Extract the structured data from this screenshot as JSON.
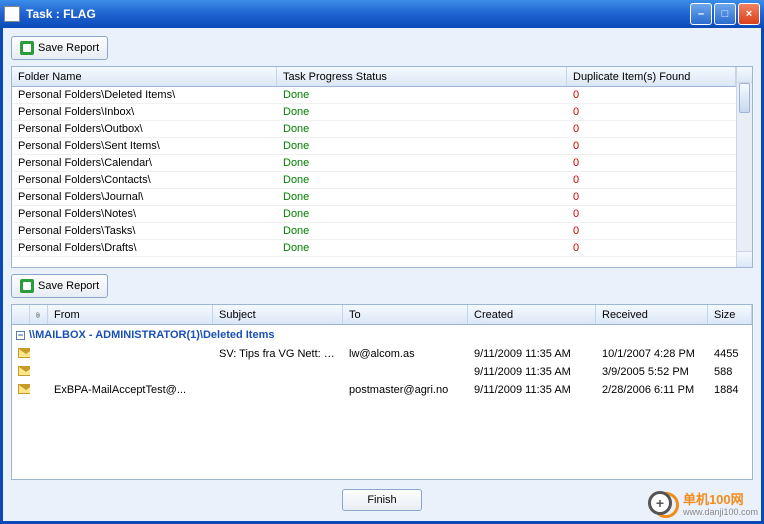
{
  "window": {
    "title": "Task : FLAG"
  },
  "toolbar": {
    "save_report": "Save Report"
  },
  "grid1": {
    "headers": {
      "folder": "Folder Name",
      "status": "Task Progress Status",
      "dup": "Duplicate Item(s) Found"
    },
    "rows": [
      {
        "folder": "Personal Folders\\Deleted Items\\",
        "status": "Done",
        "dup": "0"
      },
      {
        "folder": "Personal Folders\\Inbox\\",
        "status": "Done",
        "dup": "0"
      },
      {
        "folder": "Personal Folders\\Outbox\\",
        "status": "Done",
        "dup": "0"
      },
      {
        "folder": "Personal Folders\\Sent Items\\",
        "status": "Done",
        "dup": "0"
      },
      {
        "folder": "Personal Folders\\Calendar\\",
        "status": "Done",
        "dup": "0"
      },
      {
        "folder": "Personal Folders\\Contacts\\",
        "status": "Done",
        "dup": "0"
      },
      {
        "folder": "Personal Folders\\Journal\\",
        "status": "Done",
        "dup": "0"
      },
      {
        "folder": "Personal Folders\\Notes\\",
        "status": "Done",
        "dup": "0"
      },
      {
        "folder": "Personal Folders\\Tasks\\",
        "status": "Done",
        "dup": "0"
      },
      {
        "folder": "Personal Folders\\Drafts\\",
        "status": "Done",
        "dup": "0"
      }
    ]
  },
  "grid2": {
    "headers": {
      "from": "From",
      "subject": "Subject",
      "to": "To",
      "created": "Created",
      "received": "Received",
      "size": "Size"
    },
    "group": "\\\\MAILBOX - ADMINISTRATOR(1)\\Deleted Items",
    "rows": [
      {
        "from": "",
        "subject": "SV: Tips fra VG Nett: He...",
        "to": "lw@alcom.as",
        "created": "9/11/2009 11:35 AM",
        "received": "10/1/2007 4:28 PM",
        "size": "4455"
      },
      {
        "from": "",
        "subject": "",
        "to": "",
        "created": "9/11/2009 11:35 AM",
        "received": "3/9/2005 5:52 PM",
        "size": "588"
      },
      {
        "from": "ExBPA-MailAcceptTest@...",
        "subject": "",
        "to": "postmaster@agri.no",
        "created": "9/11/2009 11:35 AM",
        "received": "2/28/2006 6:11 PM",
        "size": "1884"
      }
    ]
  },
  "buttons": {
    "finish": "Finish"
  },
  "watermark": {
    "line1": "单机100网",
    "line2": "www.danji100.com"
  }
}
